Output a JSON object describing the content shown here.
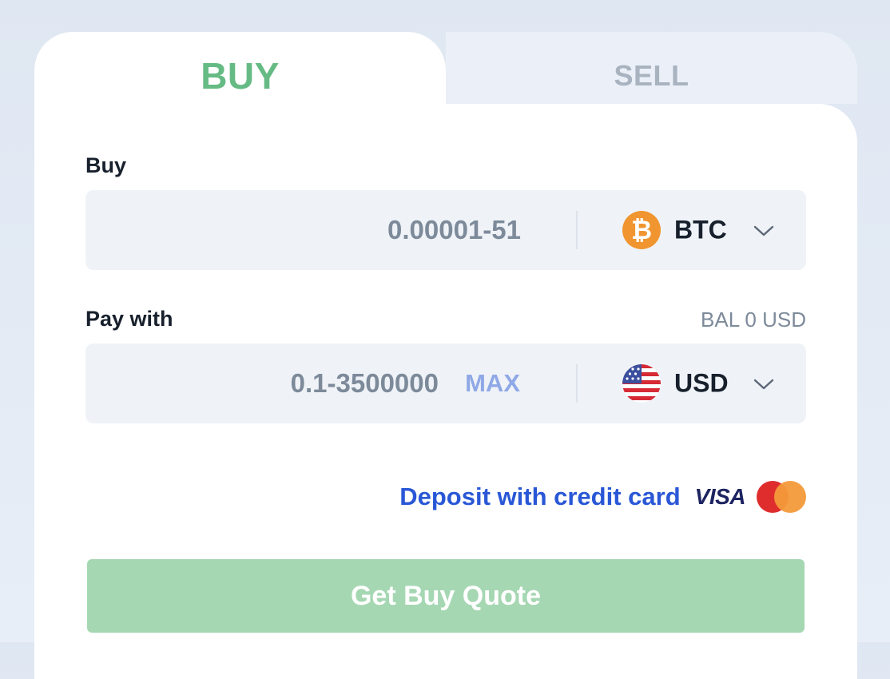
{
  "tabs": {
    "buy_label": "BUY",
    "sell_label": "SELL",
    "active": "buy"
  },
  "buy_field": {
    "label": "Buy",
    "amount_placeholder": "0.00001-51",
    "currency_code": "BTC",
    "currency_icon": "bitcoin-icon"
  },
  "pay_field": {
    "label": "Pay with",
    "balance_text": "BAL 0 USD",
    "amount_placeholder": "0.1-3500000",
    "max_label": "MAX",
    "currency_code": "USD",
    "currency_icon": "us-flag-icon"
  },
  "deposit": {
    "link_text": "Deposit with credit card",
    "card_brand_visa": "VISA",
    "card_brand_mastercard_icon": "mastercard-icon"
  },
  "cta": {
    "label": "Get Buy Quote"
  },
  "colors": {
    "accent_green": "#66bb85",
    "button_disabled_green": "#a6d7b3",
    "link_blue": "#2957d6",
    "btc_orange": "#f0952f"
  }
}
